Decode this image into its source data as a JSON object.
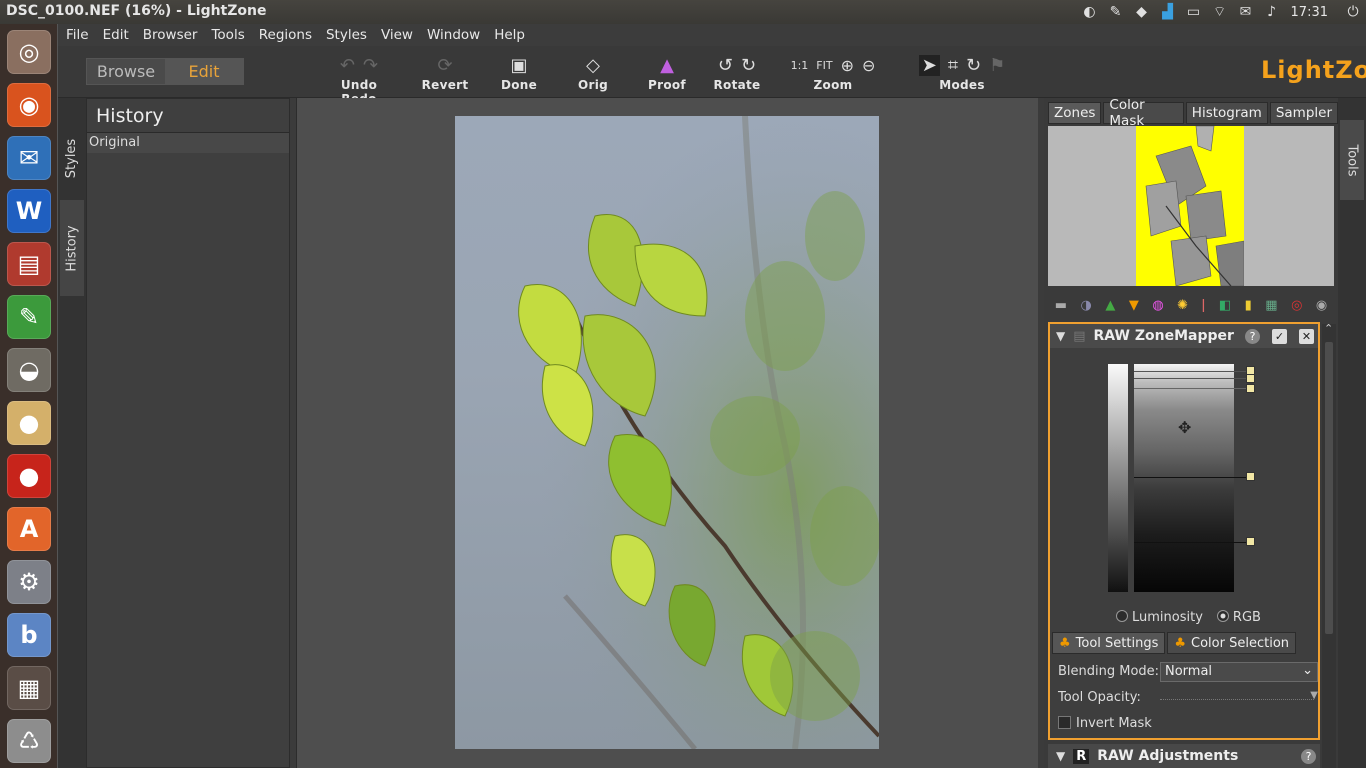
{
  "window": {
    "title": "DSC_0100.NEF (16%) - LightZone",
    "clock": "17:31"
  },
  "tray": [
    {
      "name": "indicator-icon",
      "glyph": "◐"
    },
    {
      "name": "notes-icon",
      "glyph": "✎"
    },
    {
      "name": "dropbox-icon",
      "glyph": "◆"
    },
    {
      "name": "system-monitor-icon",
      "glyph": "▟"
    },
    {
      "name": "battery-icon",
      "glyph": "▭"
    },
    {
      "name": "wifi-icon",
      "glyph": "⌔"
    },
    {
      "name": "mail-icon",
      "glyph": "✉"
    },
    {
      "name": "volume-icon",
      "glyph": "♪"
    }
  ],
  "launcher": [
    {
      "name": "ubuntu-dash-icon",
      "glyph": "◎",
      "color": "#8a6f60"
    },
    {
      "name": "firefox-icon",
      "glyph": "◉",
      "color": "#d9531e"
    },
    {
      "name": "thunderbird-icon",
      "glyph": "✉",
      "color": "#2f70b8"
    },
    {
      "name": "writer-icon",
      "glyph": "W",
      "color": "#1f5fc0"
    },
    {
      "name": "file-manager-icon",
      "glyph": "▤",
      "color": "#b03a2e"
    },
    {
      "name": "text-editor-icon",
      "glyph": "✎",
      "color": "#3c9a3c"
    },
    {
      "name": "gimp-icon",
      "glyph": "◒",
      "color": "#6f6b63"
    },
    {
      "name": "egg-icon",
      "glyph": "●",
      "color": "#d4b06a"
    },
    {
      "name": "tomato-icon",
      "glyph": "●",
      "color": "#c7241b"
    },
    {
      "name": "software-center-icon",
      "glyph": "A",
      "color": "#e2652a"
    },
    {
      "name": "settings-icon",
      "glyph": "⚙",
      "color": "#7d8088"
    },
    {
      "name": "blender-icon",
      "glyph": "b",
      "color": "#5c85c4"
    },
    {
      "name": "workspaces-icon",
      "glyph": "▦",
      "color": "#5a4d46"
    },
    {
      "name": "trash-icon",
      "glyph": "♺",
      "color": "#8d8d8d"
    }
  ],
  "menu": [
    "File",
    "Edit",
    "Browser",
    "Tools",
    "Regions",
    "Styles",
    "View",
    "Window",
    "Help"
  ],
  "toolbar": {
    "mode_browse": "Browse",
    "mode_edit": "Edit",
    "undo_redo": "Undo Redo",
    "revert": "Revert",
    "done": "Done",
    "orig": "Orig",
    "proof": "Proof",
    "rotate": "Rotate",
    "zoom": "Zoom",
    "zoom_1to1": "1:1",
    "zoom_fit": "FIT",
    "modes": "Modes",
    "brand": "LightZone"
  },
  "left": {
    "tab_styles": "Styles",
    "tab_history": "History",
    "history_title": "History",
    "history_items": [
      "Original"
    ]
  },
  "right": {
    "tabs": [
      "Zones",
      "Color Mask",
      "Histogram",
      "Sampler"
    ],
    "tools_tab": "Tools",
    "zone_mapper": {
      "title": "RAW ZoneMapper",
      "radio_luminosity": "Luminosity",
      "radio_rgb": "RGB",
      "selected": "RGB",
      "subtab_settings": "Tool Settings",
      "subtab_color": "Color Selection",
      "blending_label": "Blending Mode:",
      "blending_value": "Normal",
      "opacity_label": "Tool Opacity:",
      "opacity": 1.0,
      "invert_label": "Invert Mask"
    },
    "raw_adjustments": "RAW Adjustments"
  },
  "colors": {
    "accent": "#f5a21c",
    "panel_border": "#f0a030",
    "zone_highlight": "#ffff00"
  }
}
